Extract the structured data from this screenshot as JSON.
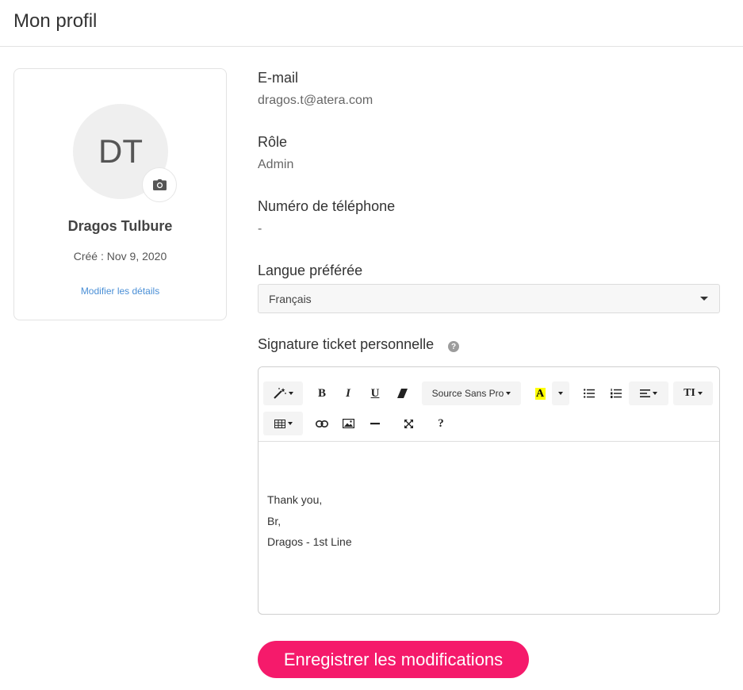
{
  "page": {
    "title": "Mon profil"
  },
  "profile": {
    "initials": "DT",
    "name": "Dragos Tulbure",
    "created": "Créé : Nov 9, 2020",
    "edit_link": "Modifier les détails",
    "camera_icon": "camera-icon"
  },
  "fields": {
    "email": {
      "label": "E-mail",
      "value": "dragos.t@atera.com"
    },
    "role": {
      "label": "Rôle",
      "value": "Admin"
    },
    "phone": {
      "label": "Numéro de téléphone",
      "value": "-"
    },
    "language": {
      "label": "Langue préférée",
      "value": "Français"
    },
    "signature": {
      "label": "Signature ticket personnelle",
      "help_icon": "?"
    }
  },
  "editor": {
    "toolbar": {
      "font_name": "Source Sans Pro",
      "help": "?",
      "bold": "B",
      "italic": "I",
      "underline": "U",
      "highlight": "A",
      "text_size": "TI"
    },
    "content": [
      "Thank you,",
      "Br,",
      "Dragos - 1st Line"
    ]
  },
  "actions": {
    "save": "Enregistrer les modifications"
  },
  "colors": {
    "accent": "#f51a6b",
    "link": "#4a8fd6",
    "highlight": "#ffff00"
  }
}
